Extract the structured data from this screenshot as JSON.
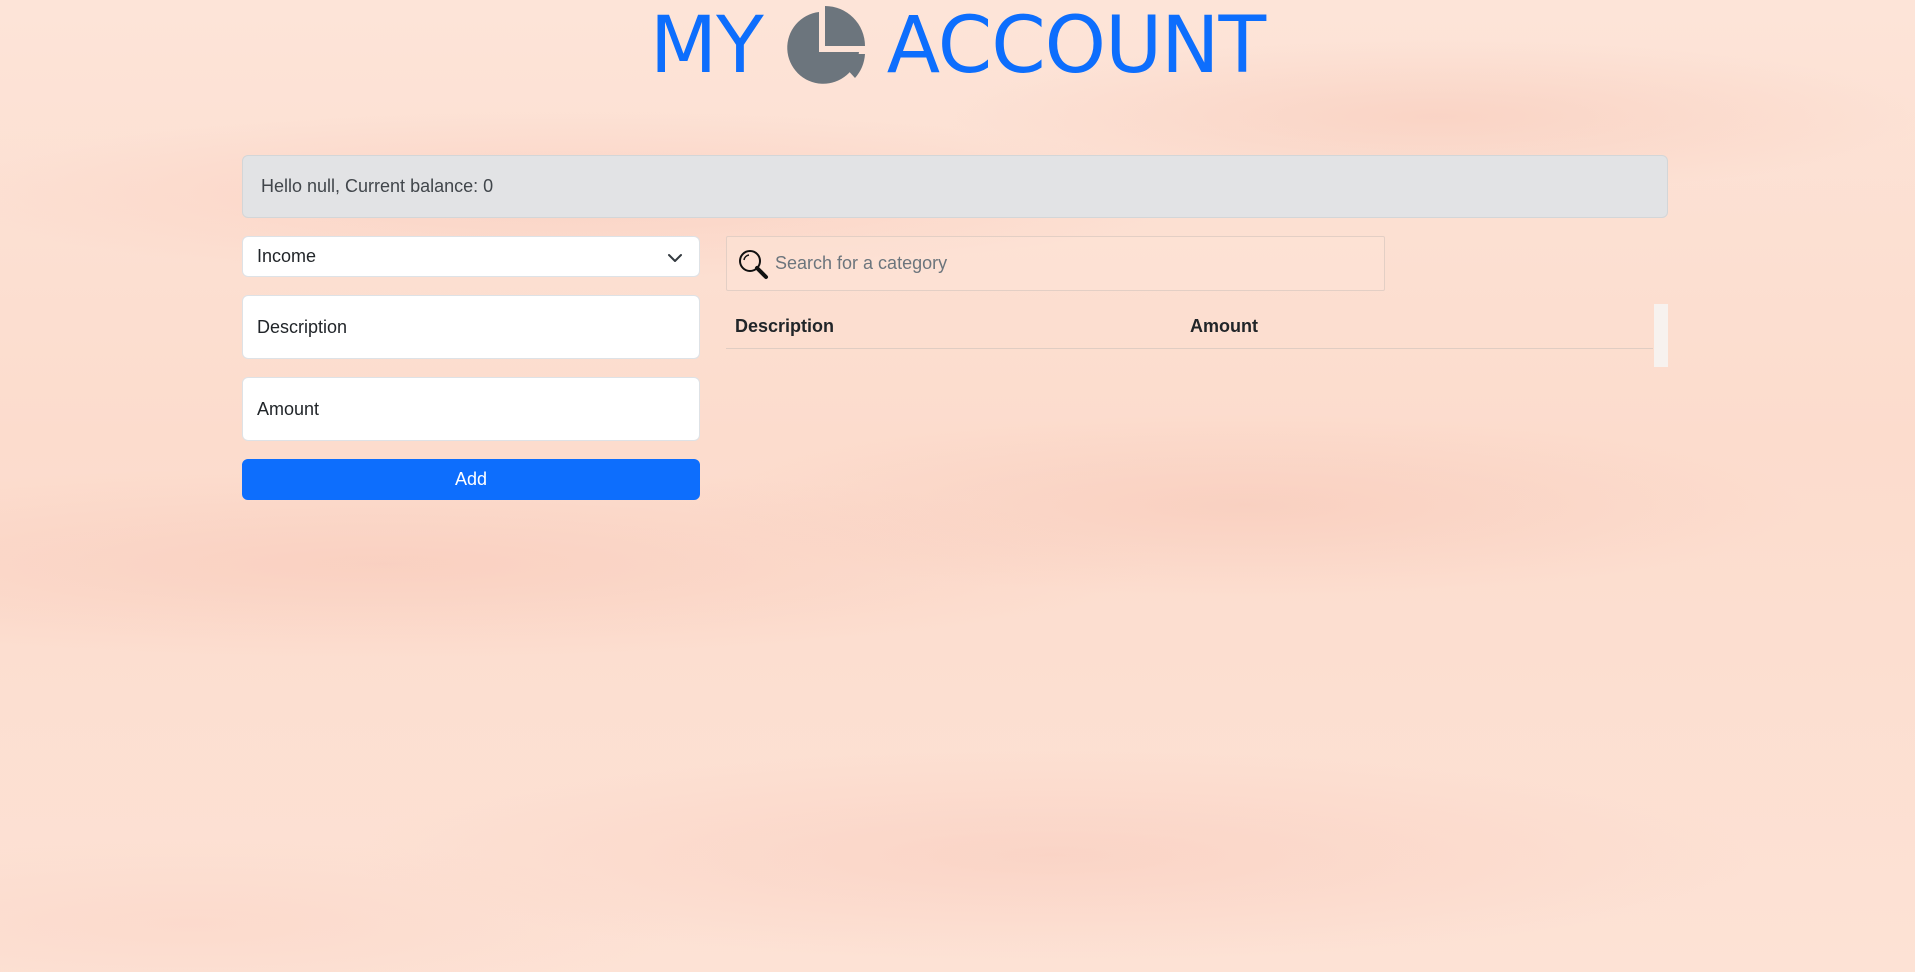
{
  "header": {
    "title_left": "MY",
    "title_right": "ACCOUNT",
    "icon": "pie-chart-icon",
    "color": "#0d6efd",
    "icon_color": "#6c757d"
  },
  "balance": {
    "text": "Hello null, Current balance: 0"
  },
  "form": {
    "type_select": {
      "selected": "Income"
    },
    "description_placeholder": "Description",
    "amount_placeholder": "Amount",
    "add_label": "Add"
  },
  "search": {
    "placeholder": "Search for a category",
    "icon": "magnifier-icon"
  },
  "table": {
    "columns": [
      "Description",
      "Amount"
    ],
    "rows": []
  },
  "colors": {
    "accent": "#0d6efd",
    "alert_background": "#e2e3e5",
    "page_background": "#fde3d6"
  }
}
